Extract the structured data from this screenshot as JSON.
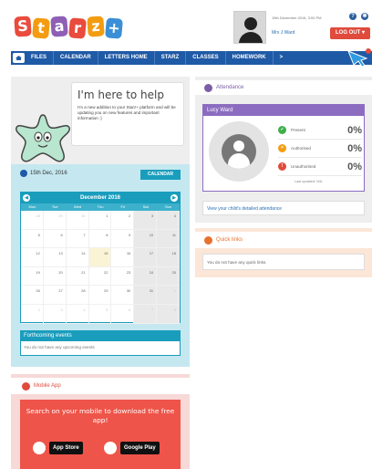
{
  "header": {
    "logo_letters": [
      "S",
      "t",
      "a",
      "r",
      "z",
      "+"
    ],
    "logo_colors": [
      "#e94b3c",
      "#f39c12",
      "#8e5fb5",
      "#e94b3c",
      "#f39c12",
      "#3a8fd6"
    ],
    "date": "15th December 2016, 3:00 PM",
    "user_name": "Mrs J Ward",
    "help_icon": "question-icon",
    "settings_icon": "gear-icon",
    "logout_label": "LOG OUT ▾"
  },
  "nav": {
    "items": [
      "FILES",
      "CALENDAR",
      "LETTERS HOME",
      "STARZ",
      "CLASSES",
      "HOMEWORK",
      ">"
    ]
  },
  "welcome": {
    "title": "I'm here to help",
    "text": "I'm a new addition to your Starz+ platform and will be updating you on new features and important information :)"
  },
  "calendar_panel": {
    "date": "15th Dec, 2016",
    "button": "CALENDAR",
    "month": "December 2016",
    "dows": [
      "Mon",
      "Tue",
      "Wed",
      "Thu",
      "Fri",
      "Sat",
      "Sun"
    ],
    "days": [
      {
        "n": "28",
        "m": true
      },
      {
        "n": "29",
        "m": true
      },
      {
        "n": "30",
        "m": true
      },
      {
        "n": "1"
      },
      {
        "n": "2"
      },
      {
        "n": "3",
        "w": true
      },
      {
        "n": "4",
        "w": true
      },
      {
        "n": "5"
      },
      {
        "n": "6"
      },
      {
        "n": "7"
      },
      {
        "n": "8"
      },
      {
        "n": "9"
      },
      {
        "n": "10",
        "w": true
      },
      {
        "n": "11",
        "w": true
      },
      {
        "n": "12"
      },
      {
        "n": "13"
      },
      {
        "n": "14"
      },
      {
        "n": "15",
        "t": true
      },
      {
        "n": "16"
      },
      {
        "n": "17",
        "w": true
      },
      {
        "n": "18",
        "w": true
      },
      {
        "n": "19"
      },
      {
        "n": "20"
      },
      {
        "n": "21"
      },
      {
        "n": "22"
      },
      {
        "n": "23"
      },
      {
        "n": "24",
        "w": true
      },
      {
        "n": "25",
        "w": true
      },
      {
        "n": "26"
      },
      {
        "n": "27"
      },
      {
        "n": "28"
      },
      {
        "n": "29"
      },
      {
        "n": "30"
      },
      {
        "n": "31",
        "w": true
      },
      {
        "n": "1",
        "m": true,
        "w": true
      },
      {
        "n": "2",
        "m": true
      },
      {
        "n": "3",
        "m": true
      },
      {
        "n": "4",
        "m": true
      },
      {
        "n": "5",
        "m": true
      },
      {
        "n": "6",
        "m": true
      },
      {
        "n": "7",
        "m": true,
        "w": true
      },
      {
        "n": "8",
        "m": true,
        "w": true
      }
    ],
    "events_title": "Forthcoming events",
    "events_text": "You do not have any upcoming events"
  },
  "mobile": {
    "title": "Mobile App",
    "text": "Search on your mobile to download the free app!",
    "app_store": "App Store",
    "google_play": "Google Play"
  },
  "attendance": {
    "title": "Attendance",
    "student": "Lucy Ward",
    "rows": [
      {
        "label": "Present",
        "pct": "0%",
        "color": "#3fae49",
        "sym": "✓"
      },
      {
        "label": "Authorised",
        "pct": "0%",
        "color": "#f39c12",
        "sym": "×"
      },
      {
        "label": "Unauthorised",
        "pct": "0%",
        "color": "#e04b3c",
        "sym": "!"
      }
    ],
    "updated": "Last updated: N/A",
    "link": "View your child's detailed attendance"
  },
  "quick_links": {
    "title": "Quick links",
    "text": "You do not have any quick links."
  }
}
